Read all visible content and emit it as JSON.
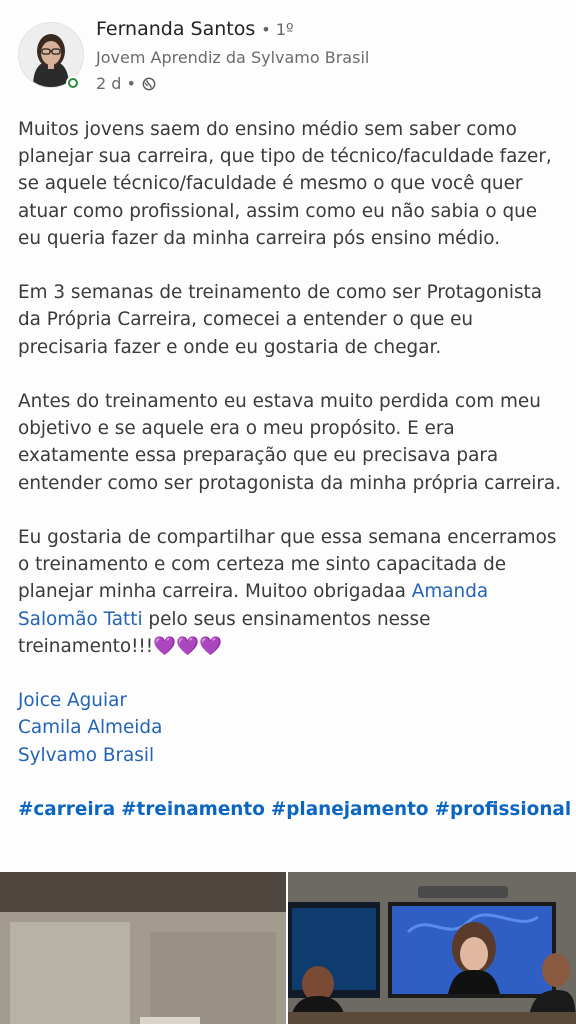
{
  "author": {
    "name": "Fernanda Santos",
    "degree": "• 1º",
    "headline": "Jovem Aprendiz da Sylvamo Brasil",
    "time": "2 d •",
    "visibility_icon": "globe-icon"
  },
  "post": {
    "paragraph1": "Muitos jovens saem do ensino médio sem saber como planejar sua carreira, que tipo de técnico/faculdade fazer, se aquele técnico/faculdade é mesmo o que você quer atuar como profissional, assim como eu não sabia o que eu queria fazer da minha carreira pós ensino médio.",
    "paragraph2": "Em 3 semanas de treinamento de como ser Protagonista da Própria Carreira, comecei a entender o que eu precisaria fazer e onde eu gostaria de chegar.",
    "paragraph3": "Antes do treinamento eu estava muito perdida com meu objetivo e se aquele era o meu propósito. E era exatamente essa preparação que eu precisava para entender como ser protagonista da minha própria carreira.",
    "paragraph4_before": "Eu gostaria de compartilhar que essa semana encerramos o treinamento e com certeza me sinto capacitada de planejar minha carreira. Muitoo obrigadaa ",
    "paragraph4_mention": "Amanda Salomão Tatti",
    "paragraph4_after": " pelo seus ensinamentos nesse treinamento!!!💜💜💜",
    "mentions": [
      "Joice Aguiar",
      "Camila Almeida",
      "Sylvamo Brasil"
    ],
    "hashtags": [
      "#carreira",
      "#treinamento",
      "#planejamento",
      "#profissional"
    ]
  },
  "colors": {
    "link": "#2464b4",
    "hashtag": "#0a66c2",
    "online": "#2a8a3e"
  }
}
